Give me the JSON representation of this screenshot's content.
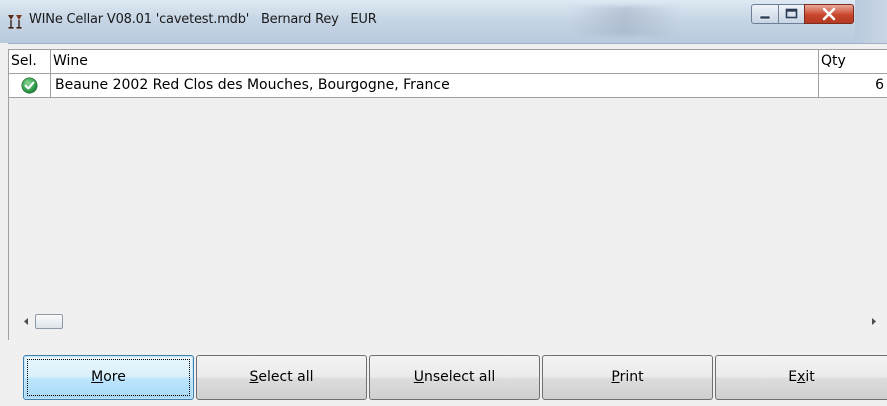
{
  "window": {
    "title": "WINe Cellar V08.01 'cavetest.mdb'   Bernard Rey   EUR"
  },
  "titlebar_buttons": {
    "minimize": "minimize-icon",
    "maximize": "maximize-icon",
    "close": "close-icon"
  },
  "grid": {
    "columns": [
      "Sel.",
      "Wine",
      "Qty"
    ],
    "rows": [
      {
        "selected": true,
        "selected_icon": "check-circle-icon",
        "wine": "Beaune 2002 Red Clos des Mouches, Bourgogne, France",
        "qty": "6"
      }
    ]
  },
  "buttons": {
    "more": {
      "mnemonic": "M",
      "rest": "ore"
    },
    "select_all": {
      "mnemonic": "S",
      "rest": "elect all"
    },
    "unselect_all": {
      "mnemonic": "U",
      "rest": "nselect all"
    },
    "print": {
      "mnemonic": "P",
      "rest": "rint"
    },
    "exit": {
      "pre": "E",
      "mnemonic": "x",
      "rest": "it"
    }
  },
  "colors": {
    "title_bar": "#c7d6e6",
    "close_button": "#c9462c",
    "check_icon": "#3aa655",
    "default_button": "#bee6fd"
  }
}
